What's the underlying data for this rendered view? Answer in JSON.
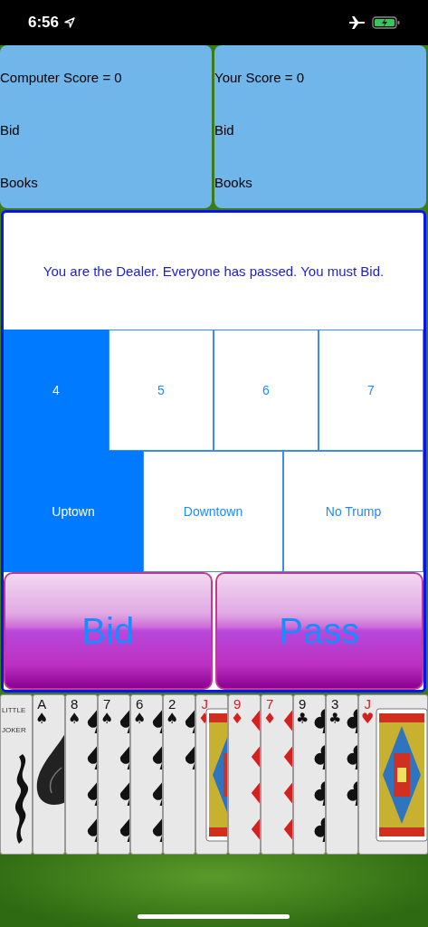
{
  "status_bar": {
    "time": "6:56"
  },
  "scores": [
    {
      "title": "Computer Score = 0",
      "bid": "Bid",
      "books": "Books"
    },
    {
      "title": "Your Score = 0",
      "bid": "Bid",
      "books": "Books"
    }
  ],
  "message": "You are the Dealer. Everyone has passed. You must Bid.",
  "bid_options": [
    {
      "label": "4",
      "selected": true
    },
    {
      "label": "5",
      "selected": false
    },
    {
      "label": "6",
      "selected": false
    },
    {
      "label": "7",
      "selected": false
    }
  ],
  "trump_options": [
    {
      "label": "Uptown",
      "selected": true
    },
    {
      "label": "Downtown",
      "selected": false
    },
    {
      "label": "No Trump",
      "selected": false
    }
  ],
  "buttons": [
    "Bid",
    "Pass"
  ],
  "hand": [
    {
      "kind": "joker",
      "label": "LITTLE JOKER"
    },
    {
      "kind": "ace",
      "rank": "A",
      "suit": "♠",
      "color": "#111111"
    },
    {
      "kind": "number",
      "rank": "8",
      "suit": "♠",
      "color": "#111111",
      "pips": [
        {
          "kind": "spade"
        },
        {
          "kind": "spade"
        },
        {
          "kind": "spade"
        },
        {
          "kind": "spade"
        }
      ]
    },
    {
      "kind": "number",
      "rank": "7",
      "suit": "♠",
      "color": "#111111",
      "pips": [
        {
          "kind": "spade"
        },
        {
          "kind": "spade"
        },
        {
          "kind": "spade"
        },
        {
          "kind": "spade"
        }
      ]
    },
    {
      "kind": "number",
      "rank": "6",
      "suit": "♠",
      "color": "#111111",
      "pips": [
        {
          "kind": "spade"
        },
        {
          "kind": "spade"
        },
        {
          "kind": "spade"
        },
        {
          "kind": "spade"
        }
      ]
    },
    {
      "kind": "number",
      "rank": "2",
      "suit": "♠",
      "color": "#111111",
      "pips": [
        {
          "kind": "spade"
        },
        {
          "kind": "spade"
        }
      ]
    },
    {
      "kind": "face",
      "rank": "J",
      "suit": "♦",
      "color": "#d42020"
    },
    {
      "kind": "number",
      "rank": "9",
      "suit": "♦",
      "color": "#d42020",
      "pips": [
        {
          "kind": "diamond"
        },
        {
          "kind": "diamond"
        },
        {
          "kind": "diamond"
        },
        {
          "kind": "diamond"
        }
      ]
    },
    {
      "kind": "number",
      "rank": "7",
      "suit": "♦",
      "color": "#d42020",
      "pips": [
        {
          "kind": "diamond"
        },
        {
          "kind": "diamond"
        },
        {
          "kind": "diamond"
        },
        {
          "kind": "diamond"
        }
      ]
    },
    {
      "kind": "number",
      "rank": "9",
      "suit": "♣",
      "color": "#111111",
      "pips": [
        {
          "kind": "club"
        },
        {
          "kind": "club"
        },
        {
          "kind": "club"
        },
        {
          "kind": "club"
        }
      ]
    },
    {
      "kind": "number",
      "rank": "3",
      "suit": "♣",
      "color": "#111111",
      "pips": [
        {
          "kind": "club"
        },
        {
          "kind": "club"
        },
        {
          "kind": "club"
        }
      ]
    },
    {
      "kind": "face",
      "rank": "J",
      "suit": "♥",
      "color": "#d42020"
    }
  ]
}
